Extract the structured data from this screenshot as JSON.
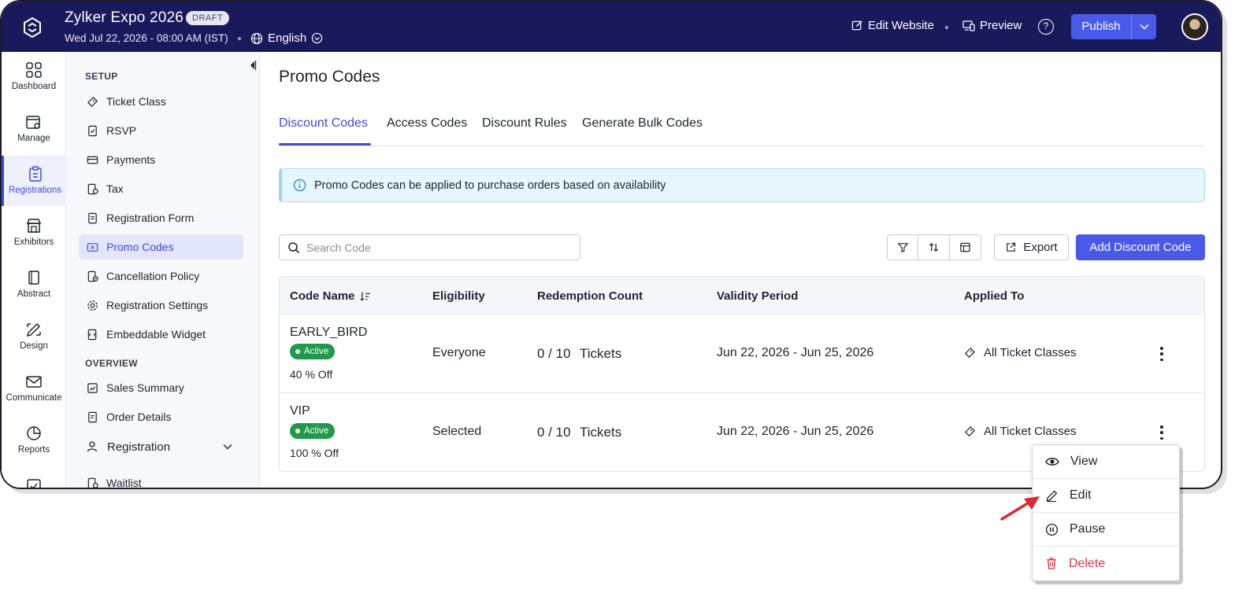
{
  "header": {
    "event_title": "Zylker Expo 2026",
    "status_badge": "DRAFT",
    "event_date": "Wed Jul 22, 2026 - 08:00 AM (IST)",
    "language": "English",
    "edit_website": "Edit Website",
    "preview": "Preview",
    "help": "?",
    "publish": "Publish"
  },
  "leftnav": {
    "items": [
      {
        "label": "Dashboard",
        "icon": "grid-icon"
      },
      {
        "label": "Manage",
        "icon": "calendar-gear-icon"
      },
      {
        "label": "Registrations",
        "icon": "clipboard-icon",
        "active": true
      },
      {
        "label": "Exhibitors",
        "icon": "store-icon"
      },
      {
        "label": "Abstract",
        "icon": "book-icon"
      },
      {
        "label": "Design",
        "icon": "pen-ruler-icon"
      },
      {
        "label": "Communicate",
        "icon": "mail-icon"
      },
      {
        "label": "Reports",
        "icon": "pie-chart-icon"
      }
    ]
  },
  "subnav": {
    "setup_heading": "SETUP",
    "setup_items": [
      {
        "label": "Ticket Class",
        "icon": "ticket-icon"
      },
      {
        "label": "RSVP",
        "icon": "rsvp-doc-icon"
      },
      {
        "label": "Payments",
        "icon": "card-icon"
      },
      {
        "label": "Tax",
        "icon": "tax-icon"
      },
      {
        "label": "Registration Form",
        "icon": "form-icon"
      },
      {
        "label": "Promo Codes",
        "icon": "promo-icon",
        "active": true
      },
      {
        "label": "Cancellation Policy",
        "icon": "cancel-doc-icon"
      },
      {
        "label": "Registration Settings",
        "icon": "gear-icon"
      },
      {
        "label": "Embeddable Widget",
        "icon": "widget-icon"
      }
    ],
    "overview_heading": "OVERVIEW",
    "overview_items": [
      {
        "label": "Sales Summary",
        "icon": "chart-icon"
      },
      {
        "label": "Order Details",
        "icon": "order-icon"
      },
      {
        "label": "Registration",
        "icon": "people-icon"
      },
      {
        "label": "Waitlist",
        "icon": "waitlist-icon"
      }
    ]
  },
  "main": {
    "title": "Promo Codes",
    "tabs": [
      "Discount Codes",
      "Access Codes",
      "Discount Rules",
      "Generate Bulk Codes"
    ],
    "info_text": "Promo Codes can be applied to purchase orders based on availability",
    "search_placeholder": "Search Code",
    "export_label": "Export",
    "add_label": "Add Discount Code",
    "table": {
      "headers": [
        "Code Name",
        "Eligibility",
        "Redemption Count",
        "Validity Period",
        "Applied To"
      ],
      "rows": [
        {
          "code": "EARLY_BIRD",
          "status": "Active",
          "discount": "40 % Off",
          "eligibility": "Everyone",
          "redemption": "0 / 10",
          "redemption_unit": "Tickets",
          "validity": "Jun 22, 2026 - Jun 25, 2026",
          "applied_to": "All Ticket Classes"
        },
        {
          "code": "VIP",
          "status": "Active",
          "discount": "100 % Off",
          "eligibility": "Selected",
          "redemption": "0 / 10",
          "redemption_unit": "Tickets",
          "validity": "Jun 22, 2026 - Jun 25, 2026",
          "applied_to": "All Ticket Classes"
        }
      ]
    }
  },
  "context_menu": {
    "items": [
      {
        "label": "View",
        "icon": "eye-icon"
      },
      {
        "label": "Edit",
        "icon": "pencil-icon"
      },
      {
        "label": "Pause",
        "icon": "pause-icon"
      },
      {
        "label": "Delete",
        "icon": "trash-icon"
      }
    ]
  },
  "colors": {
    "header_bg": "#191a5c",
    "accent": "#4a5ae8",
    "active_badge": "#1f9a4a",
    "danger": "#e0343a",
    "annotation_arrow": "#e0262b"
  }
}
